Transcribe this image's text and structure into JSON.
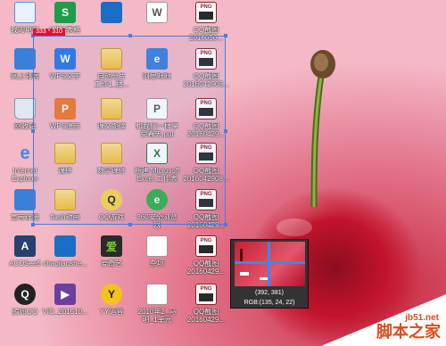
{
  "desktop": {
    "icons": [
      {
        "id": "computer-icon",
        "label": "我的电脑",
        "glyph": "",
        "style": "g-comp"
      },
      {
        "id": "wps-s-icon",
        "label": "WPS表格",
        "glyph": "S",
        "style": "g-wps-s"
      },
      {
        "id": "folder-icon",
        "label": "",
        "glyph": "",
        "style": "g-bluebox"
      },
      {
        "id": "doc-icon",
        "label": "",
        "glyph": "W",
        "style": "g-doc"
      },
      {
        "id": "png-icon",
        "label": "QQ截图\n2016050...",
        "glyph": "PNG",
        "style": "g-png"
      },
      {
        "id": "network-icon",
        "label": "网上邻居",
        "glyph": "",
        "style": "g-net"
      },
      {
        "id": "wps-w-icon",
        "label": "WPS文字",
        "glyph": "W",
        "style": "g-wps-w"
      },
      {
        "id": "folder-icon",
        "label": "自动分片\n工作1_播...",
        "glyph": "",
        "style": "g-folder"
      },
      {
        "id": "aliwangwang-icon",
        "label": "阿里旺旺",
        "glyph": "e",
        "style": "g-net"
      },
      {
        "id": "png-icon",
        "label": "QQ截图\n2016042908...",
        "glyph": "PNG",
        "style": "g-png"
      },
      {
        "id": "recycle-bin-icon",
        "label": "回收站",
        "glyph": "",
        "style": "g-bin"
      },
      {
        "id": "wps-p-icon",
        "label": "WPS演示",
        "glyph": "P",
        "style": "g-wps-p"
      },
      {
        "id": "folder-icon",
        "label": "课文朗读",
        "glyph": "",
        "style": "g-folder"
      },
      {
        "id": "ppt-icon",
        "label": "和我们一样享\n受春天.ppt",
        "glyph": "P",
        "style": "g-doc"
      },
      {
        "id": "png-icon",
        "label": "QQ截图\n20160429...",
        "glyph": "PNG",
        "style": "g-png"
      },
      {
        "id": "ie-icon",
        "label": "Internet\nExplorer",
        "glyph": "e",
        "style": "g-ie"
      },
      {
        "id": "folder-icon",
        "label": "课件",
        "glyph": "",
        "style": "g-folder"
      },
      {
        "id": "folder-icon",
        "label": "数学课件",
        "glyph": "",
        "style": "g-folder"
      },
      {
        "id": "excel-icon",
        "label": "新建 Microsoft\nExcel 工作表",
        "glyph": "X",
        "style": "g-excel"
      },
      {
        "id": "png-icon",
        "label": "QQ截图\n2016042908...",
        "glyph": "PNG",
        "style": "g-png"
      },
      {
        "id": "broadband-icon",
        "label": "宽带连接",
        "glyph": "",
        "style": "g-net"
      },
      {
        "id": "folder-icon",
        "label": "flash动画",
        "glyph": "",
        "style": "g-folder"
      },
      {
        "id": "qq-game-icon",
        "label": "QQ游戏",
        "glyph": "Q",
        "style": "g-qqgame"
      },
      {
        "id": "360-browser-icon",
        "label": "360安全浏览\n器",
        "glyph": "e",
        "style": "g-360"
      },
      {
        "id": "png-icon",
        "label": "QQ截图\n20160429...",
        "glyph": "PNG",
        "style": "g-png"
      },
      {
        "id": "acdsee-icon",
        "label": "ACDSee5",
        "glyph": "A",
        "style": "g-acd"
      },
      {
        "id": "folder-icon",
        "label": "chaojianshe...",
        "glyph": "",
        "style": "g-bluebox"
      },
      {
        "id": "aiqiyi-icon",
        "label": "爱奇艺",
        "glyph": "爱",
        "style": "g-aiqiyi"
      },
      {
        "id": "doc-icon",
        "label": "杂项",
        "glyph": "",
        "style": "g-doc"
      },
      {
        "id": "png-icon",
        "label": "QQ截图\n20160429...",
        "glyph": "PNG",
        "style": "g-png"
      },
      {
        "id": "qq-icon",
        "label": "腾讯QQ",
        "glyph": "Q",
        "style": "g-qq"
      },
      {
        "id": "video-icon",
        "label": "VID_201510...",
        "glyph": "▶",
        "style": "g-video"
      },
      {
        "id": "yy-icon",
        "label": "YY语音",
        "glyph": "Y",
        "style": "g-yy"
      },
      {
        "id": "doc-icon",
        "label": "2010年2_马\n明_1单元",
        "glyph": "",
        "style": "g-doc"
      },
      {
        "id": "png-icon",
        "label": "QQ截图\n20160429...",
        "glyph": "PNG",
        "style": "g-png"
      }
    ]
  },
  "selection": {
    "size_label": "333 * 310"
  },
  "magnifier": {
    "coord": "(392, 381)",
    "rgb": "RGB:(135, 24, 22)"
  },
  "watermark": {
    "url": "jb51.net",
    "name": "脚本之家"
  }
}
